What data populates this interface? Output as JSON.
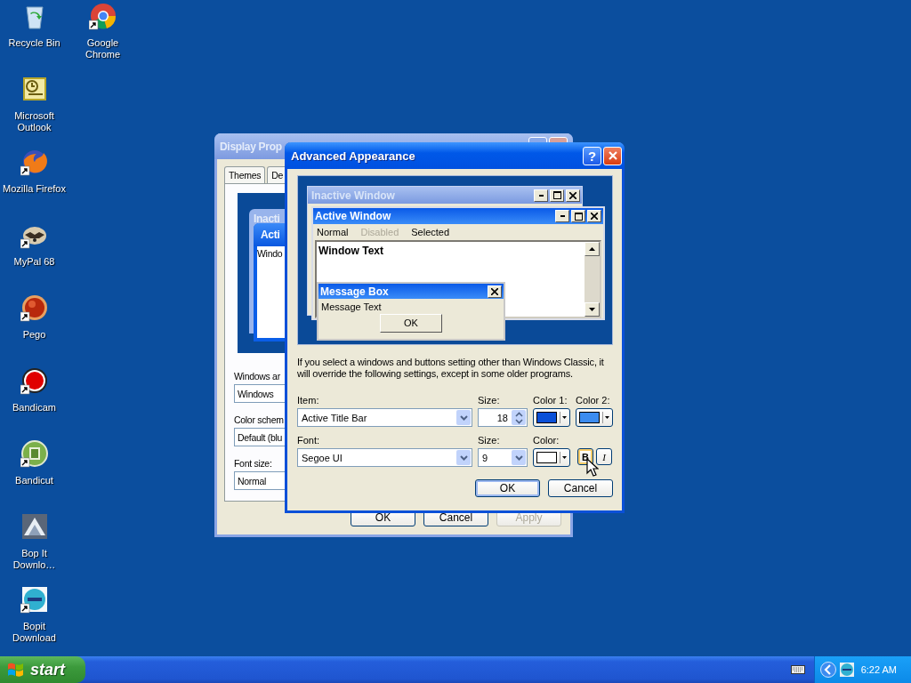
{
  "desktop_icon_rows": [
    [
      {
        "label": "Recycle Bin",
        "kind": "recycle-bin",
        "shortcut": false
      },
      {
        "label": "Google Chrome",
        "kind": "chrome",
        "shortcut": true
      }
    ],
    [
      {
        "label": "Microsoft Outlook",
        "kind": "outlook",
        "shortcut": false
      }
    ],
    [
      {
        "label": "Mozilla Firefox",
        "kind": "firefox",
        "shortcut": true
      }
    ],
    [
      {
        "label": "MyPal 68",
        "kind": "mypal",
        "shortcut": true
      }
    ],
    [
      {
        "label": "Pego",
        "kind": "pego",
        "shortcut": true
      }
    ],
    [
      {
        "label": "Bandicam",
        "kind": "bandicam",
        "shortcut": true
      }
    ],
    [
      {
        "label": "Bandicut",
        "kind": "bandicut",
        "shortcut": true
      }
    ],
    [
      {
        "label": "Bop It Downlo…",
        "kind": "bopit-downloader",
        "shortcut": false
      }
    ],
    [
      {
        "label": "Bopit Download",
        "kind": "bopit",
        "shortcut": true
      }
    ]
  ],
  "display_properties": {
    "title": "Display Prop",
    "tabs": [
      {
        "label": "Themes",
        "selected": false
      },
      {
        "label": "De",
        "selected": false
      }
    ],
    "preview": {
      "inactive_title": "Inacti",
      "active_title": "Acti",
      "window_text": "Windo"
    },
    "windows_and_buttons": {
      "label": "Windows ar",
      "value": "Windows"
    },
    "color_scheme": {
      "label": "Color schem",
      "value": "Default (blu"
    },
    "font_size": {
      "label": "Font size:",
      "value": "Normal"
    },
    "buttons": [
      {
        "label": "OK",
        "disabled": false
      },
      {
        "label": "Cancel",
        "disabled": false
      },
      {
        "label": "Apply",
        "disabled": true
      }
    ]
  },
  "advanced_appearance": {
    "title": "Advanced Appearance",
    "help": "?",
    "preview": {
      "inactive_title": "Inactive Window",
      "active_title": "Active Window",
      "menu": [
        {
          "label": "Normal",
          "disabled": false
        },
        {
          "label": "Disabled",
          "disabled": true
        },
        {
          "label": "Selected",
          "disabled": false
        }
      ],
      "window_text": "Window Text",
      "message_box": {
        "title": "Message Box",
        "text": "Message Text",
        "button": "OK"
      }
    },
    "note": "If you select a windows and buttons setting other than Windows Classic, it will override the following settings, except in some older programs.",
    "item": {
      "label": "Item:",
      "value": "Active Title Bar"
    },
    "item_size": {
      "label": "Size:",
      "value": "18"
    },
    "color_1": {
      "label": "Color 1:",
      "color": "#0a50d8"
    },
    "color_2": {
      "label": "Color 2:",
      "color": "#3c8cf0"
    },
    "font": {
      "label": "Font:",
      "value": "Segoe UI"
    },
    "font_size": {
      "label": "Size:",
      "value": "9"
    },
    "font_color": {
      "label": "Color:",
      "color": "#ffffff"
    },
    "bold": "B",
    "italic": "I",
    "buttons": [
      {
        "label": "OK",
        "default": true
      },
      {
        "label": "Cancel",
        "default": false
      }
    ]
  },
  "taskbar": {
    "start": "start",
    "clock": "6:22 AM"
  }
}
